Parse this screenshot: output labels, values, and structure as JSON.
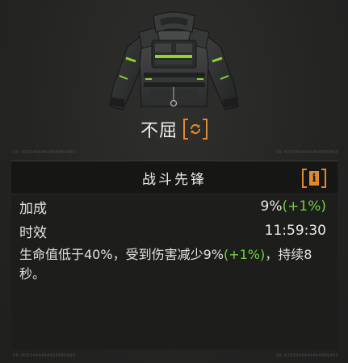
{
  "item": {
    "name": "不屈",
    "art_icon": "tactical-jacket-icon",
    "swap_icon": "swap-cycle-icon"
  },
  "serials": {
    "top_left": "10-02034944444648B9483",
    "top_right": "10-02034944444648B9483",
    "bottom_left": "10-02034944444648B9483",
    "bottom_right": "10-02034944444648B9483"
  },
  "perk": {
    "title": "战斗先锋",
    "info_glyph": "i",
    "stats": [
      {
        "label": "加成",
        "value": "9%",
        "bonus": "(+1%)"
      },
      {
        "label": "时效",
        "value": "11:59:30"
      }
    ],
    "description_prefix": "生命值低于40%，受到伤害减少9%",
    "description_bonus": "(+1%)",
    "description_suffix": "，持续8秒。"
  },
  "colors": {
    "accent_orange": "#e08a2c",
    "bonus_green": "#6fd23a",
    "jacket_trim_green": "#8cd630",
    "background": "#242423",
    "panel": "#1d1d1c"
  }
}
